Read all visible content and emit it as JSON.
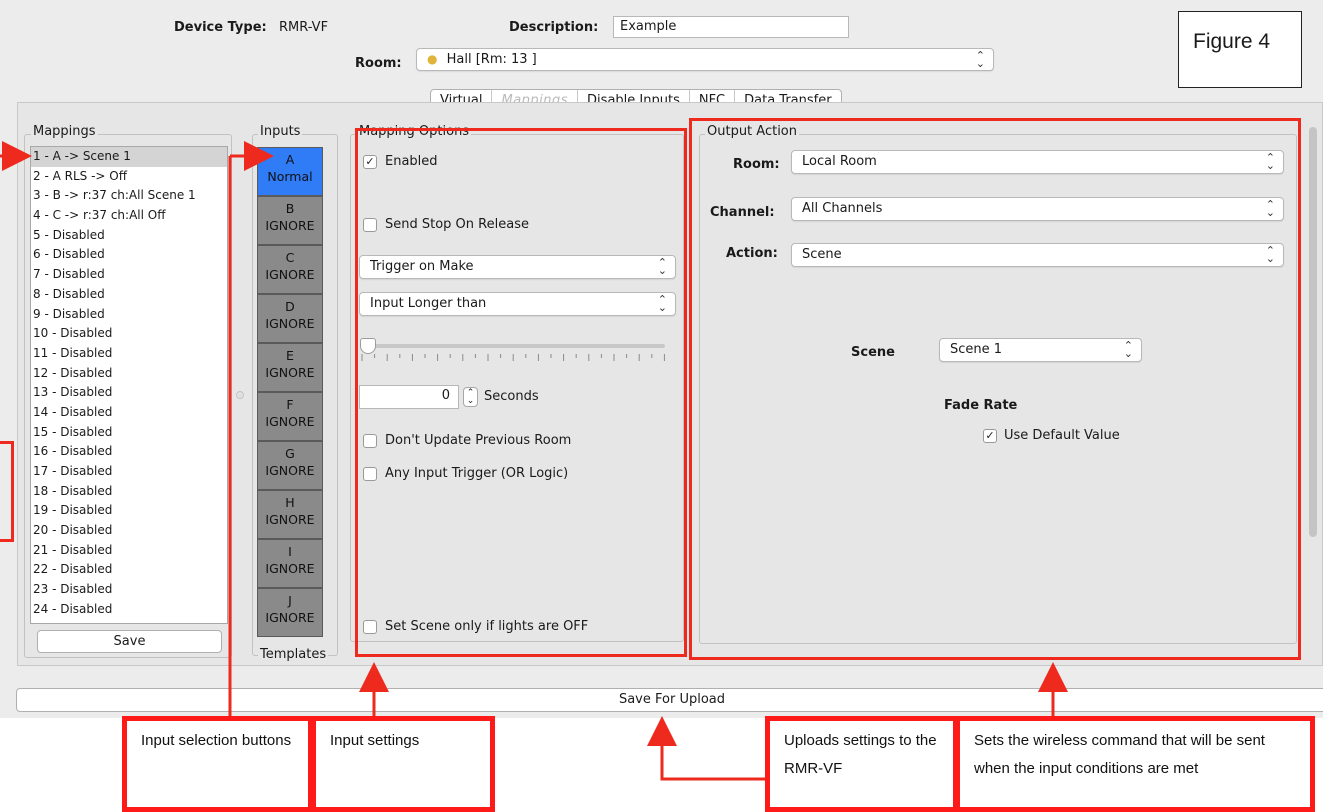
{
  "figure_label": "Figure 4",
  "header": {
    "device_type_label": "Device Type:",
    "device_type_value": "RMR-VF",
    "description_label": "Description:",
    "description_value": "Example",
    "room_label": "Room:",
    "room_value": "Hall [Rm: 13 ]"
  },
  "tabs": [
    {
      "label": "Virtual",
      "active": false
    },
    {
      "label": "Mappings",
      "active": true
    },
    {
      "label": "Disable Inputs",
      "active": false
    },
    {
      "label": "NFC",
      "active": false
    },
    {
      "label": "Data Transfer",
      "active": false
    }
  ],
  "mappings": {
    "title": "Mappings",
    "items": [
      "1 - A -> Scene 1",
      "2 - A RLS -> Off",
      "3 - B -> r:37 ch:All Scene 1",
      "4 - C -> r:37 ch:All Off",
      "5 - Disabled",
      "6 - Disabled",
      "7 - Disabled",
      "8 - Disabled",
      "9 - Disabled",
      "10 - Disabled",
      "11 - Disabled",
      "12 - Disabled",
      "13 - Disabled",
      "14 - Disabled",
      "15 - Disabled",
      "16 - Disabled",
      "17 - Disabled",
      "18 - Disabled",
      "19 - Disabled",
      "20 - Disabled",
      "21 - Disabled",
      "22 - Disabled",
      "23 - Disabled",
      "24 - Disabled"
    ],
    "selected_index": 0,
    "save_label": "Save"
  },
  "inputs": {
    "title": "Inputs",
    "templates_title": "Templates",
    "buttons": [
      {
        "letter": "A",
        "mode": "Normal",
        "active": true
      },
      {
        "letter": "B",
        "mode": "IGNORE",
        "active": false
      },
      {
        "letter": "C",
        "mode": "IGNORE",
        "active": false
      },
      {
        "letter": "D",
        "mode": "IGNORE",
        "active": false
      },
      {
        "letter": "E",
        "mode": "IGNORE",
        "active": false
      },
      {
        "letter": "F",
        "mode": "IGNORE",
        "active": false
      },
      {
        "letter": "G",
        "mode": "IGNORE",
        "active": false
      },
      {
        "letter": "H",
        "mode": "IGNORE",
        "active": false
      },
      {
        "letter": "I",
        "mode": "IGNORE",
        "active": false
      },
      {
        "letter": "J",
        "mode": "IGNORE",
        "active": false
      }
    ]
  },
  "mapping_options": {
    "title": "Mapping Options",
    "enabled_label": "Enabled",
    "enabled_checked": true,
    "send_stop_label": "Send Stop On Release",
    "send_stop_checked": false,
    "trigger_value": "Trigger on Make",
    "duration_value": "Input Longer than",
    "seconds_value": "0",
    "seconds_label": "Seconds",
    "dont_update_label": "Don't Update Previous Room",
    "dont_update_checked": false,
    "any_input_label": "Any Input Trigger (OR Logic)",
    "any_input_checked": false,
    "set_scene_label": "Set Scene only if lights are OFF",
    "set_scene_checked": false
  },
  "output_action": {
    "title": "Output Action",
    "room_label": "Room:",
    "room_value": "Local Room",
    "channel_label": "Channel:",
    "channel_value": "All Channels",
    "action_label": "Action:",
    "action_value": "Scene",
    "scene_label": "Scene",
    "scene_value": "Scene 1",
    "fade_rate_label": "Fade Rate",
    "use_default_label": "Use Default Value",
    "use_default_checked": true
  },
  "save_upload_label": "Save For Upload",
  "callouts": {
    "input_selection": "Input selection buttons",
    "input_settings": "Input settings",
    "uploads": "Uploads settings to the RMR-VF",
    "wireless": "Sets the wireless command that will be sent when the input conditions are met"
  },
  "colors": {
    "annotation_red": "#ee2a1e",
    "active_input_blue": "#2f7cf6",
    "inactive_input_gray": "#8a8a8a",
    "window_bg": "#ececec"
  },
  "icons": {
    "room_icon": "lightbulb-icon",
    "select_icon": "chevron-updown-icon",
    "check_icon": "checkmark-icon"
  }
}
